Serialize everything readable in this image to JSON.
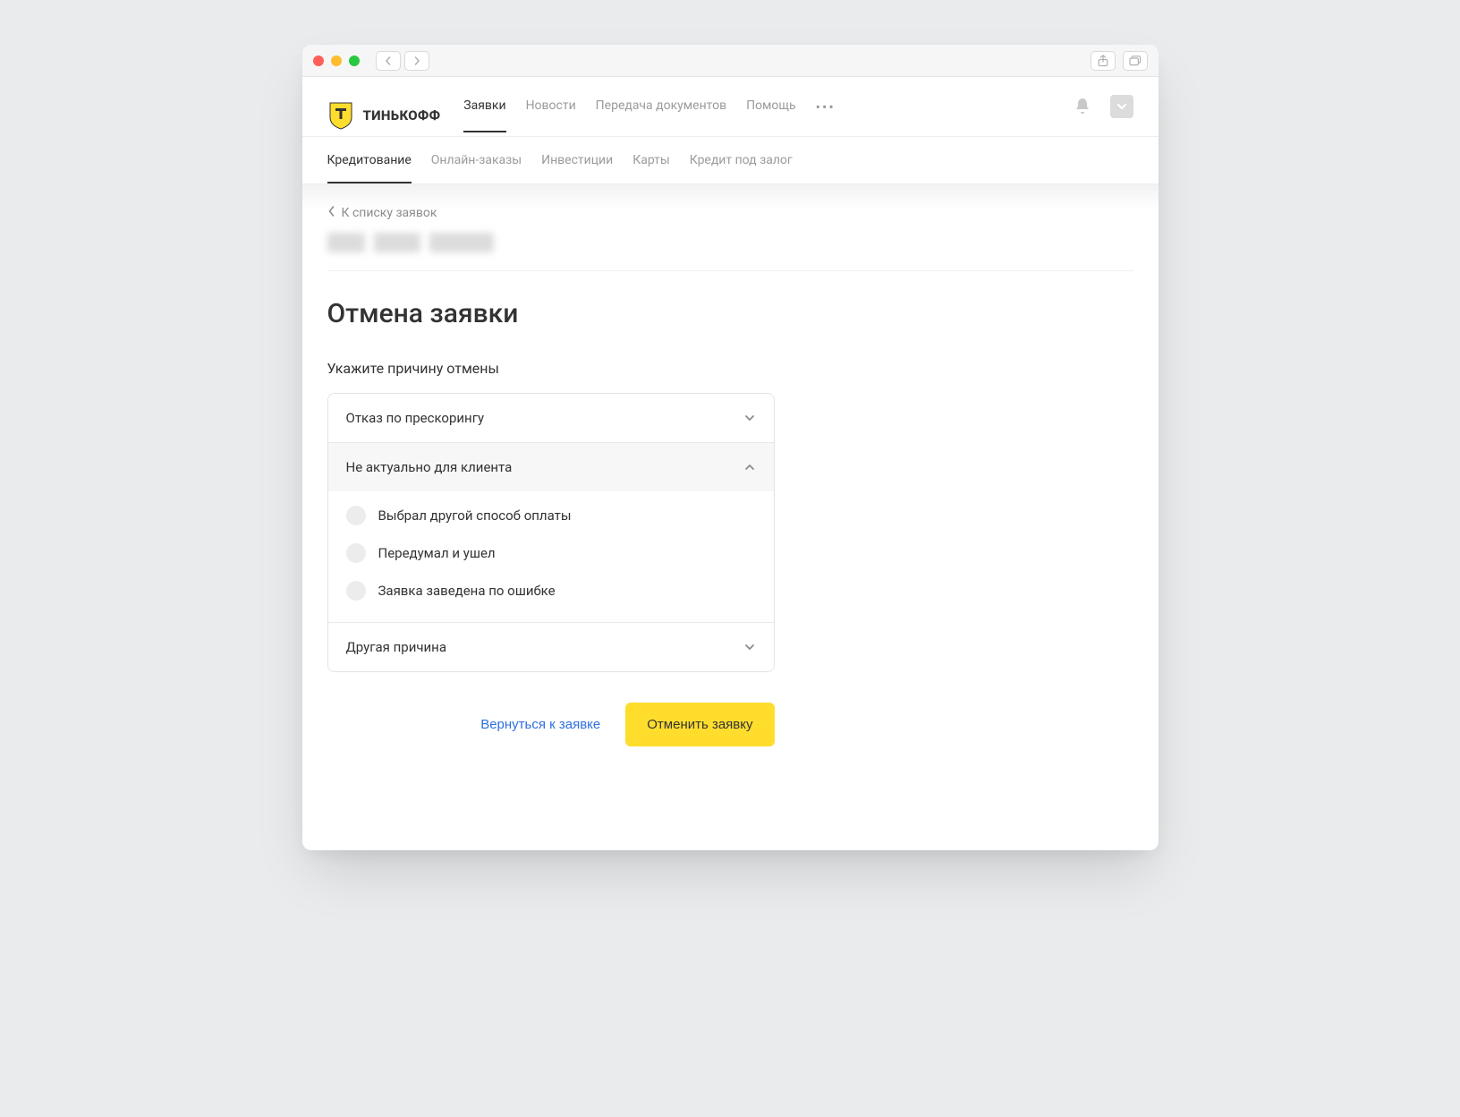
{
  "brand": {
    "name": "ТИНЬКОФФ"
  },
  "primaryTabs": {
    "items": [
      {
        "label": "Заявки",
        "active": true
      },
      {
        "label": "Новости"
      },
      {
        "label": "Передача документов"
      },
      {
        "label": "Помощь"
      }
    ]
  },
  "subTabs": {
    "items": [
      {
        "label": "Кредитование",
        "active": true
      },
      {
        "label": "Онлайн-заказы"
      },
      {
        "label": "Инвестиции"
      },
      {
        "label": "Карты"
      },
      {
        "label": "Кредит под залог"
      }
    ]
  },
  "breadcrumb": {
    "label": "К списку заявок"
  },
  "page": {
    "title": "Отмена заявки",
    "prompt": "Укажите причину отмены"
  },
  "accordion": {
    "items": [
      {
        "label": "Отказ по прескорингу",
        "expanded": false
      },
      {
        "label": "Не актуально для клиента",
        "expanded": true,
        "options": [
          {
            "label": "Выбрал другой способ оплаты"
          },
          {
            "label": "Передумал и ушел"
          },
          {
            "label": "Заявка заведена по ошибке"
          }
        ]
      },
      {
        "label": "Другая причина",
        "expanded": false
      }
    ]
  },
  "actions": {
    "back": "Вернуться к заявке",
    "cancel": "Отменить заявку"
  },
  "colors": {
    "accent": "#ffdd2d",
    "link": "#2f6fe0"
  }
}
